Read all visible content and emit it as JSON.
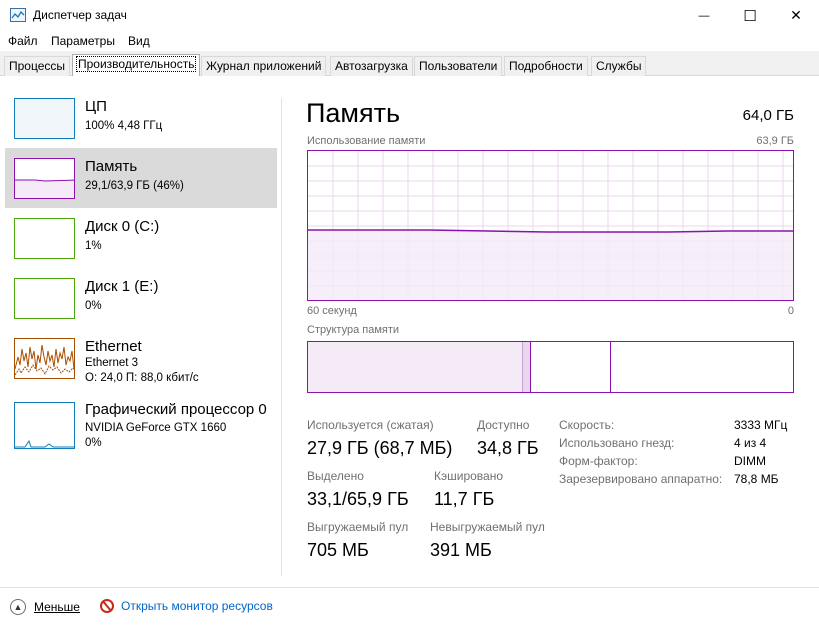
{
  "window": {
    "title": "Диспетчер задач",
    "minimize_glyph": "—",
    "maximize_glyph": "☐",
    "close_glyph": "✕"
  },
  "menu": {
    "items": [
      "Файл",
      "Параметры",
      "Вид"
    ]
  },
  "tabs": [
    "Процессы",
    "Производительность",
    "Журнал приложений",
    "Автозагрузка",
    "Пользователи",
    "Подробности",
    "Службы"
  ],
  "active_tab": "Производительность",
  "sidebar": {
    "items": [
      {
        "title": "ЦП",
        "line1": "100%  4,48 ГГц",
        "line2": "",
        "color": "#117dbb"
      },
      {
        "title": "Память",
        "line1": "29,1/63,9 ГБ (46%)",
        "line2": "",
        "color": "#8b12ae"
      },
      {
        "title": "Диск 0 (C:)",
        "line1": "1%",
        "line2": "",
        "color": "#4da60c"
      },
      {
        "title": "Диск 1 (E:)",
        "line1": "0%",
        "line2": "",
        "color": "#4da60c"
      },
      {
        "title": "Ethernet",
        "line1": "Ethernet 3",
        "line2": "О: 24,0  П: 88,0 кбит/с",
        "color": "#a74f01"
      },
      {
        "title": "Графический процессор 0",
        "line1": "NVIDIA GeForce GTX 1660",
        "line2": "0%",
        "color": "#117dbb"
      }
    ],
    "selected": "Память"
  },
  "main": {
    "title": "Память",
    "total": "64,0 ГБ",
    "usage_label": "Использование памяти",
    "usage_max": "63,9 ГБ",
    "axis_left": "60 секунд",
    "axis_right": "0",
    "structure_label": "Структура памяти",
    "stats": {
      "in_use_label": "Используется (сжатая)",
      "in_use_value": "27,9 ГБ (68,7 МБ)",
      "available_label": "Доступно",
      "available_value": "34,8 ГБ",
      "committed_label": "Выделено",
      "committed_value": "33,1/65,9 ГБ",
      "cached_label": "Кэшировано",
      "cached_value": "11,7 ГБ",
      "paged_label": "Выгружаемый пул",
      "paged_value": "705 МБ",
      "nonpaged_label": "Невыгружаемый пул",
      "nonpaged_value": "391 МБ"
    },
    "details": [
      {
        "label": "Скорость:",
        "value": "3333 МГц"
      },
      {
        "label": "Использовано гнезд:",
        "value": "4 из 4"
      },
      {
        "label": "Форм-фактор:",
        "value": "DIMM"
      },
      {
        "label": "Зарезервировано аппаратно:",
        "value": "78,8 МБ"
      }
    ],
    "accent_color": "#8b12ae",
    "usage_fraction": 0.46
  },
  "footer": {
    "less_label": "Меньше",
    "monitor_label": "Открыть монитор ресурсов"
  }
}
